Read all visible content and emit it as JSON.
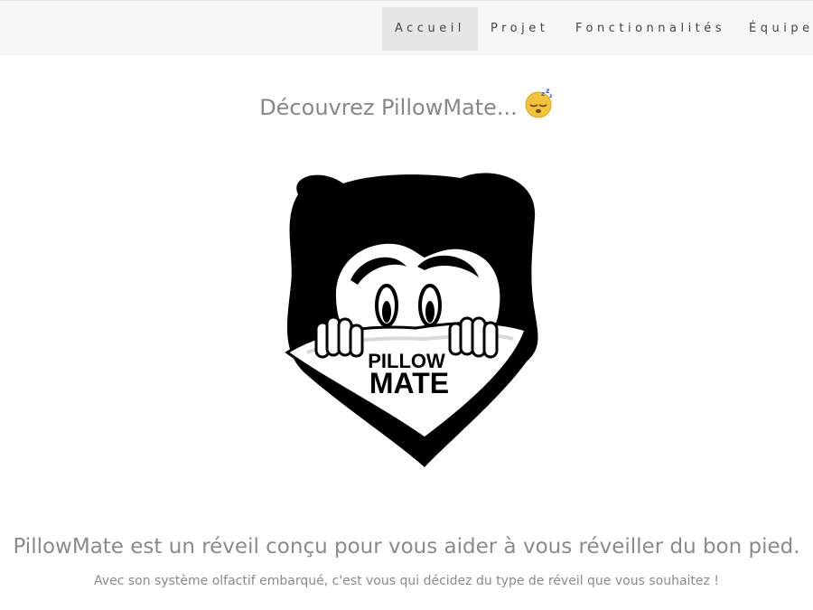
{
  "nav": {
    "items": [
      {
        "label": "Accueil",
        "active": true
      },
      {
        "label": "Projet",
        "active": false
      },
      {
        "label": "Fonctionnalités",
        "active": false
      },
      {
        "label": "Équipe",
        "active": false
      }
    ]
  },
  "hero": {
    "heading": "Découvrez PillowMate...",
    "heading_icon": "sleeping-face-icon"
  },
  "logo": {
    "line1": "PILLOW",
    "line2": "MATE",
    "colors": {
      "ink": "#000000",
      "paper": "#ffffff",
      "shade": "#d9d9d9"
    }
  },
  "intro": {
    "tagline": "PillowMate est un réveil conçu pour vous aider à vous réveiller du bon pied.",
    "subtext": "Avec son système olfactif embarqué, c'est vous qui décidez du type de réveil que vous souhaitez !"
  }
}
